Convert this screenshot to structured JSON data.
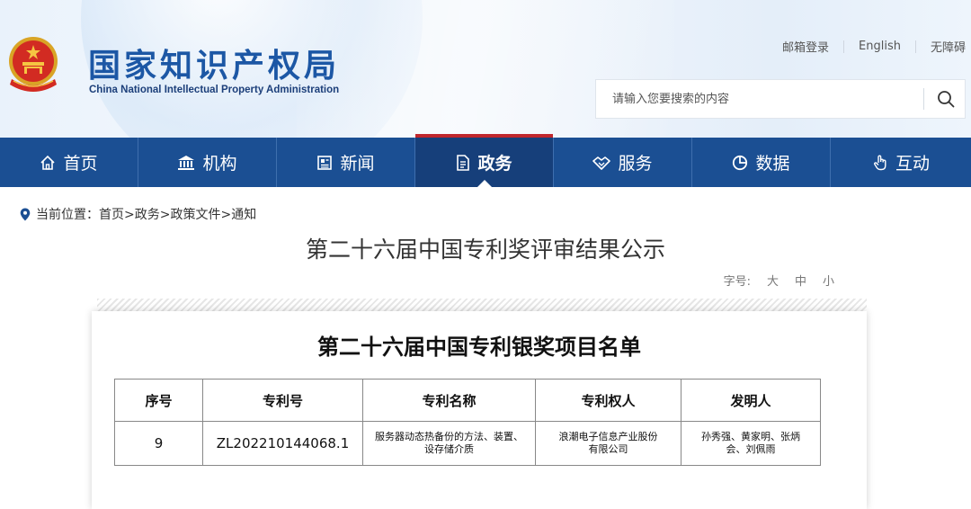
{
  "header": {
    "logo_cn": "国家知识产权局",
    "logo_en": "China National Intellectual Property Administration",
    "top_links": [
      "邮箱登录",
      "English",
      "无障碍"
    ],
    "search_placeholder": "请输入您要搜索的内容",
    "icons": {
      "emblem": "national-emblem-icon",
      "search": "search-icon"
    }
  },
  "nav": {
    "items": [
      {
        "label": "首页",
        "icon": "home-icon"
      },
      {
        "label": "机构",
        "icon": "institution-icon"
      },
      {
        "label": "新闻",
        "icon": "news-icon"
      },
      {
        "label": "政务",
        "icon": "document-icon",
        "active": true
      },
      {
        "label": "服务",
        "icon": "handshake-icon"
      },
      {
        "label": "数据",
        "icon": "pie-chart-icon"
      },
      {
        "label": "互动",
        "icon": "hand-pointer-icon"
      }
    ]
  },
  "breadcrumb": {
    "text": "当前位置：首页>政务>政策文件>通知"
  },
  "page": {
    "title": "第二十六届中国专利奖评审结果公示",
    "font_size_label": "字号:",
    "font_sizes": [
      "大",
      "中",
      "小"
    ]
  },
  "document": {
    "title": "第二十六届中国专利银奖项目名单",
    "table": {
      "headers": [
        "序号",
        "专利号",
        "专利名称",
        "专利权人",
        "发明人"
      ],
      "rows": [
        [
          "9",
          "ZL202210144068.1",
          "服务器动态热备份的方法、装置、设存储介质",
          "浪潮电子信息产业股份有限公司",
          "孙秀强、黄家明、张炳会、刘佩雨"
        ]
      ]
    }
  },
  "colors": {
    "nav_bg": "#1b4f93",
    "nav_active": "#163f7a",
    "accent_red": "#c0272d",
    "logo_blue": "#1c57a5"
  }
}
